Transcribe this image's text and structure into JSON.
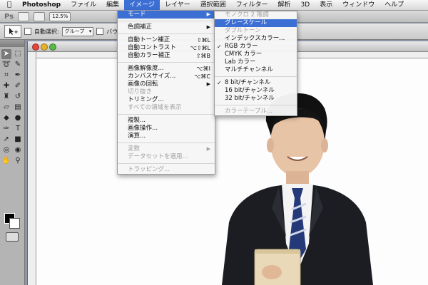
{
  "menubar": {
    "apple_icon": "",
    "items": [
      "Photoshop",
      "ファイル",
      "編集",
      "イメージ",
      "レイヤー",
      "選択範囲",
      "フィルター",
      "解析",
      "3D",
      "表示",
      "ウィンドウ",
      "ヘルプ"
    ],
    "active": "イメージ"
  },
  "appbar": {
    "logo": "Ps",
    "zoom": "12.5%"
  },
  "optionsbar": {
    "auto_select_label": "自動選択:",
    "auto_select_value": "グループ",
    "transform_label": "バウ"
  },
  "image_menu": {
    "groups": [
      [
        {
          "label": "モード",
          "submenu": true,
          "highlighted": true
        }
      ],
      [
        {
          "label": "色調補正",
          "submenu": true
        }
      ],
      [
        {
          "label": "自動トーン補正",
          "shortcut": "⇧⌘L"
        },
        {
          "label": "自動コントラスト",
          "shortcut": "⌥⇧⌘L"
        },
        {
          "label": "自動カラー補正",
          "shortcut": "⇧⌘B"
        }
      ],
      [
        {
          "label": "画像解像度...",
          "shortcut": "⌥⌘I"
        },
        {
          "label": "カンバスサイズ...",
          "shortcut": "⌥⌘C"
        },
        {
          "label": "画像の回転",
          "submenu": true
        },
        {
          "label": "切り抜き",
          "disabled": true
        },
        {
          "label": "トリミング..."
        },
        {
          "label": "すべての領域を表示",
          "disabled": true
        }
      ],
      [
        {
          "label": "複製..."
        },
        {
          "label": "画像操作..."
        },
        {
          "label": "演算..."
        }
      ],
      [
        {
          "label": "変数",
          "submenu": true,
          "disabled": true
        },
        {
          "label": "データセットを適用...",
          "disabled": true
        }
      ],
      [
        {
          "label": "トラッピング...",
          "disabled": true
        }
      ]
    ]
  },
  "mode_menu": {
    "groups": [
      [
        {
          "label": "モノクロ 2 階調",
          "disabled": true
        },
        {
          "label": "グレースケール",
          "highlighted": true
        },
        {
          "label": "ダブルトーン",
          "disabled": true
        },
        {
          "label": "インデックスカラー..."
        },
        {
          "label": "RGB カラー",
          "checked": true
        },
        {
          "label": "CMYK カラー"
        },
        {
          "label": "Lab カラー"
        },
        {
          "label": "マルチチャンネル"
        }
      ],
      [
        {
          "label": "8 bit/チャンネル",
          "checked": true
        },
        {
          "label": "16 bit/チャンネル"
        },
        {
          "label": "32 bit/チャンネル"
        }
      ],
      [
        {
          "label": "カラーテーブル...",
          "disabled": true
        }
      ]
    ]
  },
  "tools": [
    "move-tool",
    "marquee-tool",
    "lasso-tool",
    "quick-select-tool",
    "crop-tool",
    "eyedropper-tool",
    "healing-brush-tool",
    "brush-tool",
    "clone-stamp-tool",
    "history-brush-tool",
    "eraser-tool",
    "gradient-tool",
    "blur-tool",
    "dodge-tool",
    "pen-tool",
    "type-tool",
    "path-select-tool",
    "shape-tool",
    "3d-rotate-tool",
    "3d-orbit-tool",
    "hand-tool",
    "zoom-tool"
  ],
  "colors": {
    "accent": "#3c6fd4",
    "foreground": "#000000",
    "background": "#ffffff"
  }
}
